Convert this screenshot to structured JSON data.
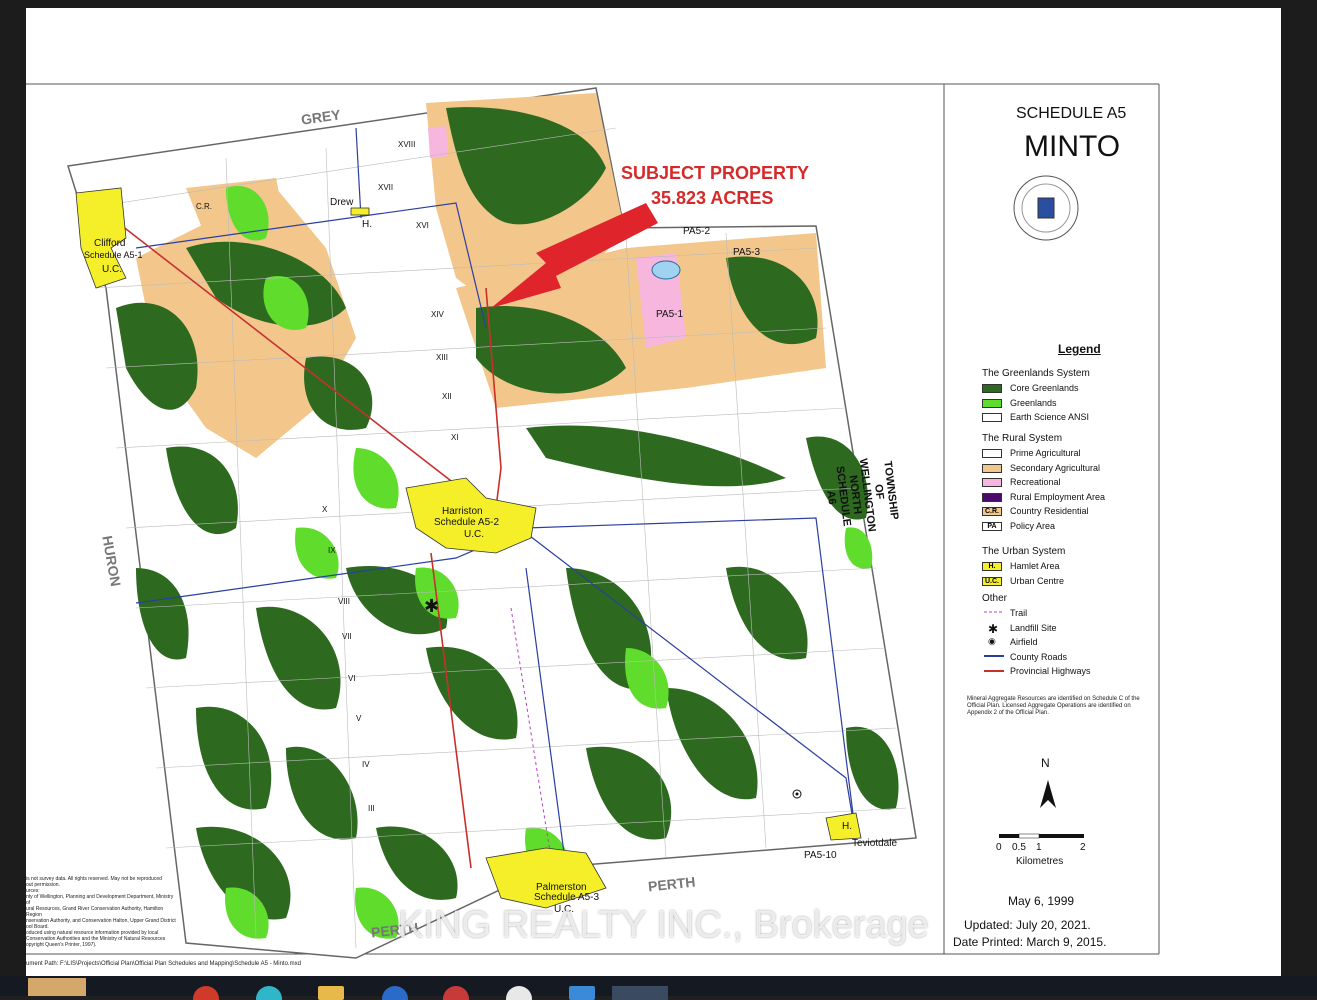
{
  "schedule": "SCHEDULE A5",
  "municipality": "MINTO",
  "subject": {
    "line1": "SUBJECT PROPERTY",
    "line2": "35.823 ACRES"
  },
  "legend": {
    "title": "Legend",
    "groups": [
      {
        "title": "The Greenlands System",
        "items": [
          {
            "label": "Core Greenlands",
            "color": "#2d6a1f"
          },
          {
            "label": "Greenlands",
            "color": "#5fdc2c"
          },
          {
            "label": "Earth Science ANSI",
            "color": "#ffffff"
          }
        ]
      },
      {
        "title": "The Rural System",
        "items": [
          {
            "label": "Prime Agricultural",
            "color": "#ffffff"
          },
          {
            "label": "Secondary Agricultural",
            "color": "#f3c78c"
          },
          {
            "label": "Recreational",
            "color": "#f7b6de"
          },
          {
            "label": "Rural Employment Area",
            "color": "#4b0a6b"
          },
          {
            "label": "Country Residential",
            "color": "#f3c78c",
            "code": "C.R."
          },
          {
            "label": "Policy Area",
            "color": "#ffffff",
            "code": "PA"
          }
        ]
      },
      {
        "title": "The Urban System",
        "items": [
          {
            "label": "Hamlet Area",
            "color": "#f5ef2a",
            "code": "H."
          },
          {
            "label": "Urban Centre",
            "color": "#f5ef2a",
            "code": "U.C."
          }
        ]
      },
      {
        "title": "Other",
        "items": [
          {
            "label": "Trail",
            "color": "#b040c0"
          },
          {
            "label": "Landfill Site",
            "color": "#111111"
          },
          {
            "label": "Airfield",
            "color": "#111111"
          },
          {
            "label": "County Roads",
            "color": "#2a3fa0"
          },
          {
            "label": "Provincial Highways",
            "color": "#c8302c"
          }
        ]
      }
    ]
  },
  "note": "Mineral Aggregate Resources are identified on Schedule C of the Official Plan. Licensed Aggregate Operations are identified on Appendix 2 of the Official Plan.",
  "north": "N",
  "scale": {
    "ticks": [
      "0",
      "0.5",
      "1",
      "2"
    ],
    "unit": "Kilometres"
  },
  "dates": {
    "original": "May 6, 1999",
    "updated": "Updated:  July 20, 2021.",
    "printed": "Date Printed:  March 9, 2015."
  },
  "borders": {
    "north": "GREY",
    "west": "HURON",
    "south_1": "PERTH",
    "south_2": "PERTH",
    "east": "TOWNSHIP OF WELLINGTON NORTH SCHEDULE A6"
  },
  "places": {
    "clifford": "Clifford",
    "clifford_sched": "Schedule A5-1",
    "clifford_uc": "U.C.",
    "drew": "Drew",
    "drew_h": "H.",
    "harriston": "Harriston",
    "harriston_sched": "Schedule A5-2",
    "harriston_uc": "U.C.",
    "palmerston": "Palmerston",
    "palmerston_sched": "Schedule A5-3",
    "palmerston_uc": "U.C.",
    "teviotdale": "Teviotdale",
    "teviotdale_h": "H.",
    "pa52": "PA5-2",
    "pa53": "PA5-3",
    "pa51": "PA5-1",
    "pa510": "PA5-10",
    "cr": "C.R."
  },
  "concessions": [
    "XVIII",
    "XVII",
    "XVI",
    "XIV",
    "XIII",
    "XII",
    "XI",
    "X",
    "IX",
    "VIII",
    "VII",
    "VI",
    "V",
    "IV",
    "III"
  ],
  "source_notes": [
    "is not survey data. All rights reserved. May not be reproduced",
    "out permission.",
    "urces:",
    "nty of Wellington, Planning and Development Department, Ministry of",
    "ural Resources, Grand River Conservation Authority, Hamilton Region",
    "nservation Authority, and Conservation Halton, Upper Grand District",
    "ool Board.",
    "oduced using natural resource information provided by local",
    "Conservation Authorities and the Ministry of Natural Resources",
    "opyright Queen's Printer, 1997)."
  ],
  "path_note": "ument Path: F:\\LIS\\Projects\\Official Plan\\Official Plan Schedules and Mapping\\Schedule A5 - Minto.mxd",
  "watermark": "KING REALTY INC., Brokerage"
}
